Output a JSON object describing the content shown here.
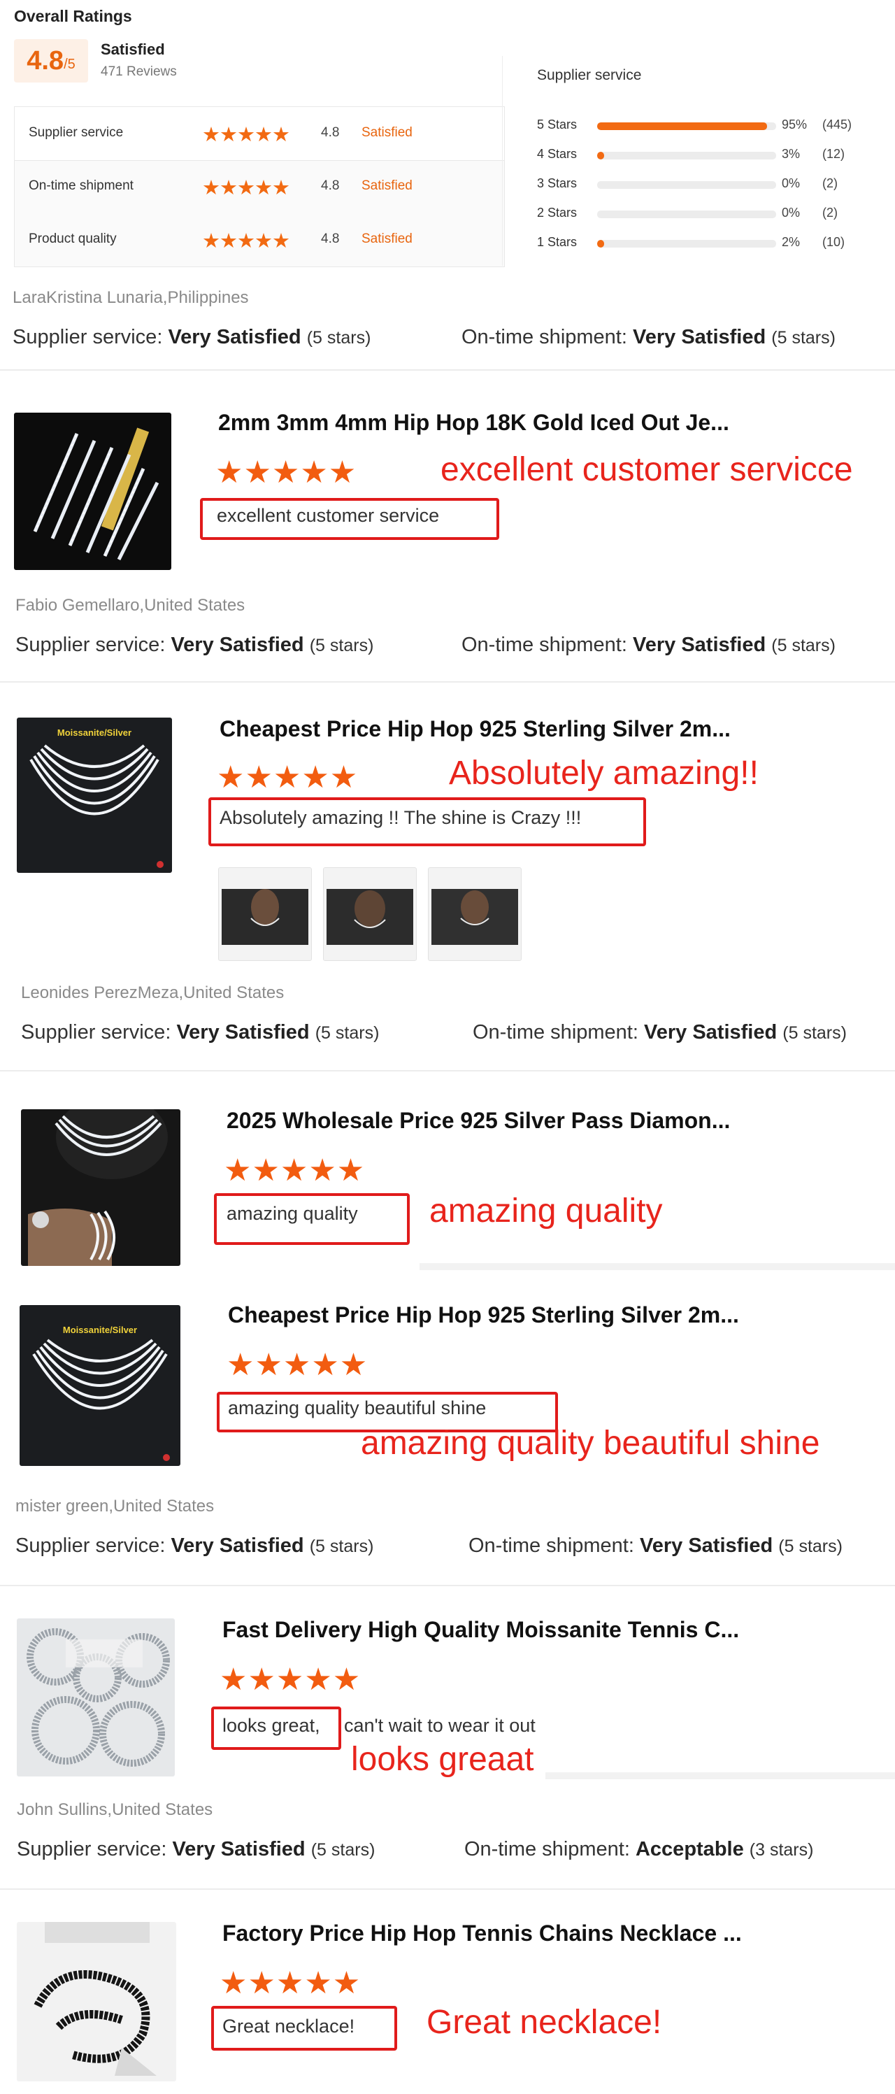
{
  "overall": {
    "title": "Overall Ratings",
    "score": "4.8",
    "score_suffix": "/5",
    "label": "Satisfied",
    "review_count": "471 Reviews",
    "categories": [
      {
        "name": "Supplier service",
        "stars": "★★★★★",
        "score": "4.8",
        "status": "Satisfied"
      },
      {
        "name": "On-time shipment",
        "stars": "★★★★★",
        "score": "4.8",
        "status": "Satisfied"
      },
      {
        "name": "Product quality",
        "stars": "★★★★★",
        "score": "4.8",
        "status": "Satisfied"
      }
    ],
    "distribution_title": "Supplier service",
    "distribution": [
      {
        "label": "5 Stars",
        "fraction": 0.95,
        "percent": "95%",
        "count": "(445)"
      },
      {
        "label": "4 Stars",
        "fraction": 0.03,
        "percent": "3%",
        "count": "(12)"
      },
      {
        "label": "3 Stars",
        "fraction": 0.0,
        "percent": "0%",
        "count": "(2)"
      },
      {
        "label": "2 Stars",
        "fraction": 0.0,
        "percent": "0%",
        "count": "(2)"
      },
      {
        "label": "1 Stars",
        "fraction": 0.02,
        "percent": "2%",
        "count": "(10)"
      }
    ]
  },
  "labels": {
    "supplier_service": "Supplier service:",
    "on_time_shipment": "On-time shipment:"
  },
  "reviews": [
    {
      "reviewer": "LaraKristina Lunaria,Philippines",
      "supplier_rating": "Very Satisfied",
      "supplier_stars": "(5 stars)",
      "shipment_rating": "Very Satisfied",
      "shipment_stars": "(5 stars)",
      "products": [
        {
          "title": "2mm 3mm 4mm Hip Hop 18K Gold Iced Out Je...",
          "stars": "★★★★★",
          "comment": "excellent customer service",
          "annotation": "excellent customer servicce"
        }
      ]
    },
    {
      "reviewer": "Fabio Gemellaro,United States",
      "supplier_rating": "Very Satisfied",
      "supplier_stars": "(5 stars)",
      "shipment_rating": "Very Satisfied",
      "shipment_stars": "(5 stars)",
      "products": [
        {
          "title": "Cheapest Price Hip Hop 925 Sterling Silver 2m...",
          "stars": "★★★★★",
          "comment": "Absolutely amazing !! The shine is Crazy !!!",
          "annotation": "Absolutely amazing!!",
          "thumb_label": "Moissanite/Silver"
        }
      ]
    },
    {
      "reviewer": "Leonides PerezMeza,United States",
      "supplier_rating": "Very Satisfied",
      "supplier_stars": "(5 stars)",
      "shipment_rating": "Very Satisfied",
      "shipment_stars": "(5 stars)",
      "products": [
        {
          "title": "2025 Wholesale Price 925 Silver Pass Diamon...",
          "stars": "★★★★★",
          "comment": "amazing quality",
          "annotation": "amazing quality"
        },
        {
          "title": "Cheapest Price Hip Hop 925 Sterling Silver 2m...",
          "stars": "★★★★★",
          "comment": "amazing quality beautiful shine",
          "annotation": "amazing quality beautiful shine",
          "thumb_label": "Moissanite/Silver"
        }
      ]
    },
    {
      "reviewer": "mister green,United States",
      "supplier_rating": "Very Satisfied",
      "supplier_stars": "(5 stars)",
      "shipment_rating": "Very Satisfied",
      "shipment_stars": "(5 stars)",
      "products": [
        {
          "title": "Fast Delivery High Quality Moissanite Tennis C...",
          "stars": "★★★★★",
          "comment_boxed": "looks great,",
          "comment_rest": "can't wait to wear it out",
          "annotation": "looks greaat"
        }
      ]
    },
    {
      "reviewer": "John Sullins,United States",
      "supplier_rating": "Very Satisfied",
      "supplier_stars": "(5 stars)",
      "shipment_rating": "Acceptable",
      "shipment_stars": "(3 stars)",
      "products": [
        {
          "title": "Factory Price Hip Hop Tennis Chains Necklace ...",
          "stars": "★★★★★",
          "comment": "Great necklace!",
          "annotation": "Great necklace!"
        }
      ]
    }
  ],
  "colors": {
    "accent": "#f26a12",
    "annotation_red": "#e01b1b",
    "score_bg": "#fdf0e6"
  }
}
